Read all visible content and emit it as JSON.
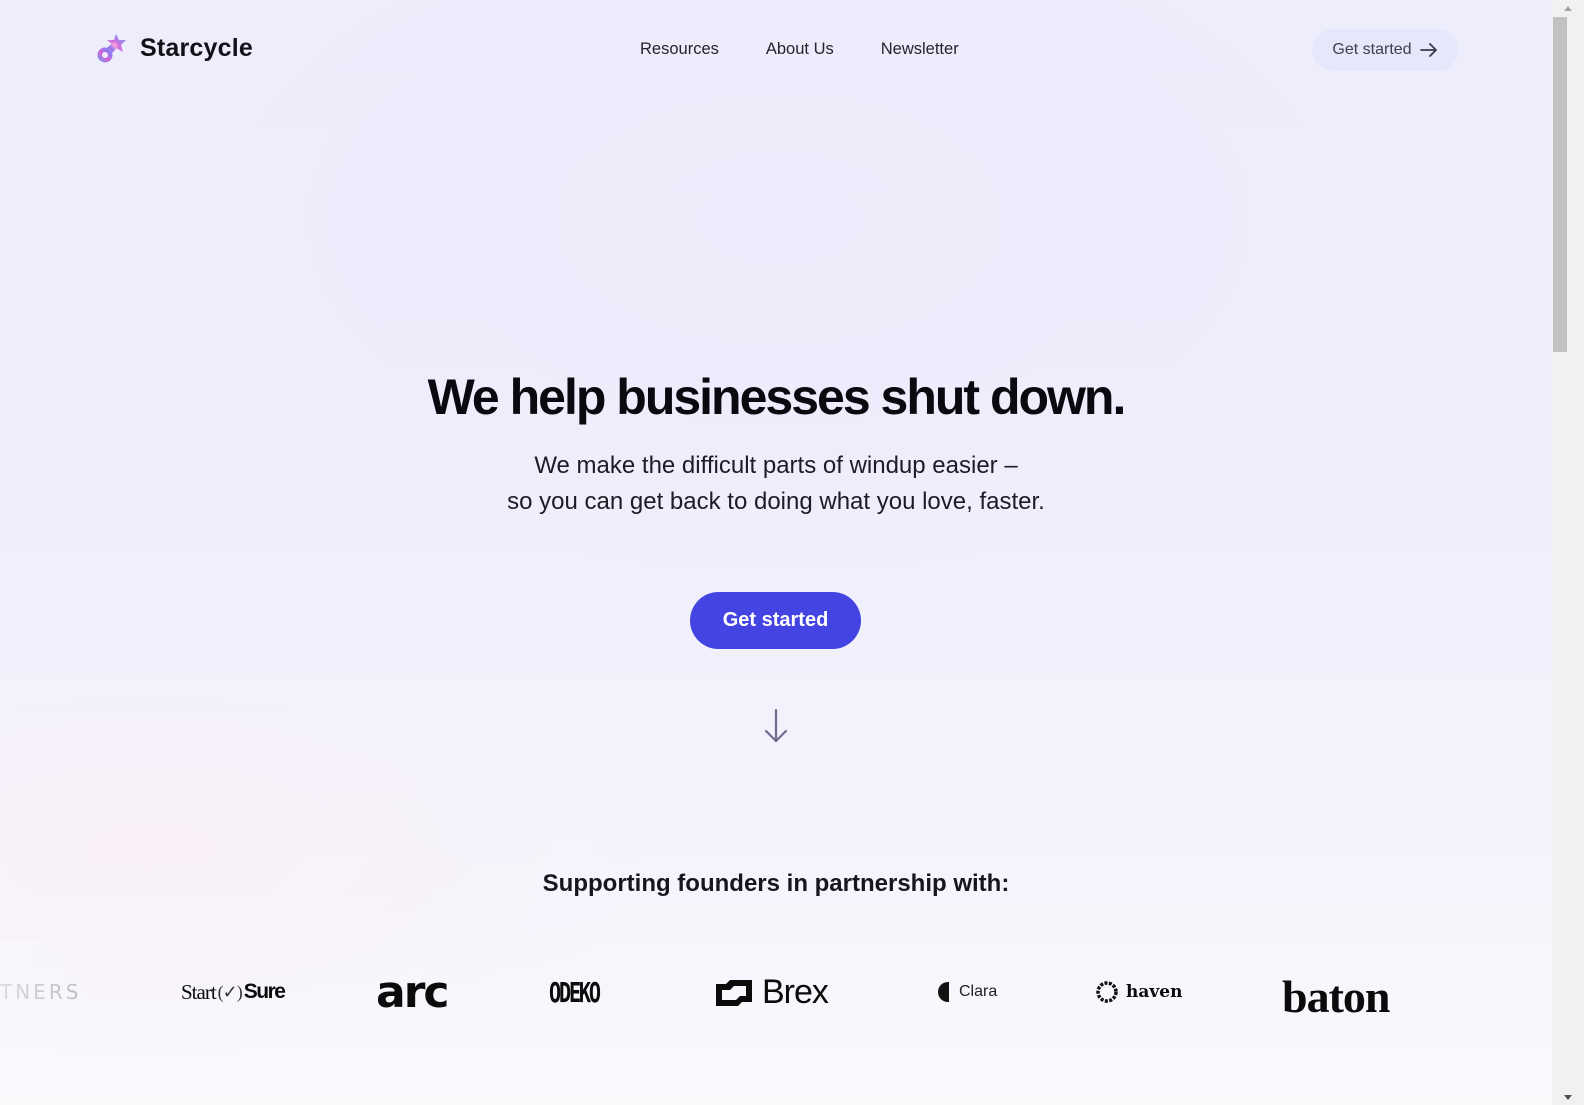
{
  "header": {
    "brand_name": "Starcycle",
    "brand_icon": "starcycle-logo-icon",
    "nav": [
      {
        "label": "Resources"
      },
      {
        "label": "About Us"
      },
      {
        "label": "Newsletter"
      }
    ],
    "cta_label": "Get started",
    "cta_icon": "arrow-right-icon"
  },
  "hero": {
    "title": "We help businesses shut down.",
    "subtitle_lines": [
      "We make the difficult parts of windup easier –",
      "so you can get back to doing what you love, faster."
    ],
    "cta_label": "Get started",
    "scroll_icon": "arrow-down-icon"
  },
  "partners": {
    "title": "Supporting founders in partnership with:",
    "logos": [
      {
        "name": "TNERS"
      },
      {
        "name": "Start",
        "name_suffix": "Sure",
        "check": "(✓)"
      },
      {
        "name": "arc"
      },
      {
        "name": "ODEKO"
      },
      {
        "name": "Brex"
      },
      {
        "name": "Clara"
      },
      {
        "name": "haven"
      },
      {
        "name": "baton"
      }
    ]
  },
  "colors": {
    "accent": "#4444e2",
    "background_top": "#eeedfc",
    "background_bottom": "#faf9fc",
    "text": "#0b0b12"
  }
}
